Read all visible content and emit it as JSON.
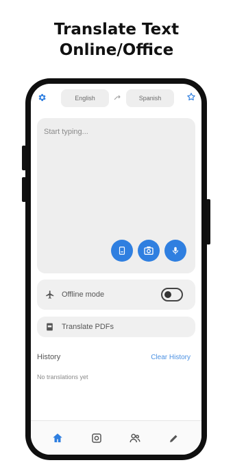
{
  "headline": {
    "line1": "Translate Text",
    "line2": "Online/Office"
  },
  "topbar": {
    "settings_icon": "gear-icon",
    "source_language": "English",
    "swap_icon": "swap-icon",
    "target_language": "Spanish",
    "favorite_icon": "star-icon"
  },
  "editor": {
    "placeholder": "Start typing...",
    "actions": [
      {
        "icon": "document-icon"
      },
      {
        "icon": "camera-icon"
      },
      {
        "icon": "microphone-icon"
      }
    ]
  },
  "offline": {
    "label": "Offline mode",
    "icon": "airplane-icon",
    "enabled": false
  },
  "pdf": {
    "label": "Translate PDFs",
    "icon": "pdf-icon"
  },
  "history": {
    "title": "History",
    "clear_label": "Clear History",
    "empty_message": "No translations yet"
  },
  "navbar": {
    "items": [
      {
        "icon": "home-icon",
        "active": true
      },
      {
        "icon": "camera-scan-icon",
        "active": false
      },
      {
        "icon": "conversation-icon",
        "active": false
      },
      {
        "icon": "pen-icon",
        "active": false
      }
    ]
  },
  "colors": {
    "accent": "#2f7fe0",
    "card": "#eeeeee",
    "text": "#555555"
  }
}
